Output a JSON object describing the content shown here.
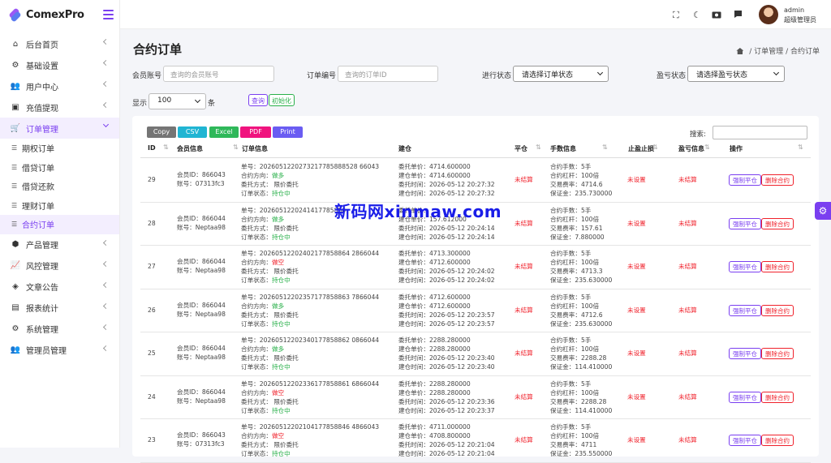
{
  "brand": {
    "name": "ComexPro"
  },
  "colors": {
    "accent": "#7a3ff0",
    "danger": "#f0212b",
    "success": "#29b04a"
  },
  "sidebar": {
    "items": [
      {
        "label": "后台首页",
        "icon": "gauge-icon"
      },
      {
        "label": "基础设置",
        "icon": "cogs-icon"
      },
      {
        "label": "用户中心",
        "icon": "users-icon"
      },
      {
        "label": "充值提现",
        "icon": "money-icon"
      },
      {
        "label": "订单管理",
        "icon": "cart-icon"
      },
      {
        "label": "产品管理",
        "icon": "cubes-icon"
      },
      {
        "label": "风控管理",
        "icon": "chart-icon"
      },
      {
        "label": "文章公告",
        "icon": "layers-icon"
      },
      {
        "label": "报表统计",
        "icon": "report-icon"
      },
      {
        "label": "系统管理",
        "icon": "gear-icon"
      },
      {
        "label": "管理员管理",
        "icon": "admins-icon"
      }
    ],
    "sub": [
      "期权订单",
      "借贷订单",
      "借贷还款",
      "理财订单",
      "合约订单"
    ]
  },
  "user": {
    "name": "admin",
    "role": "超级管理员"
  },
  "page": {
    "title": "合约订单",
    "bc1": "订单管理",
    "bc2": "合约订单",
    "sep": "/"
  },
  "filters": {
    "member_label": "会员账号",
    "member_ph": "查询的会员账号",
    "order_label": "订单编号",
    "order_ph": "查询的订单ID",
    "status_label": "进行状态",
    "status_value": "请选择订单状态",
    "pl_label": "盈亏状态",
    "pl_value": "请选择盈亏状态",
    "show_label": "显示",
    "show_value": "100",
    "show_unit": "条",
    "query": "查询",
    "reset": "初始化"
  },
  "export": [
    "Copy",
    "CSV",
    "Excel",
    "PDF",
    "Print"
  ],
  "search_label": "搜索:",
  "headers": [
    "ID",
    "会员信息",
    "订单信息",
    "建仓",
    "平仓",
    "手数信息",
    "止盈止损",
    "盈亏信息",
    "操作"
  ],
  "rows": [
    {
      "id": "29",
      "m1": "会员ID：866043",
      "m2": "账号：07313fc3",
      "o1": "单号：2026051220273217785888528 66043",
      "o2p": "合约方向：",
      "dir": "做多",
      "o3": "委托方式：  限价委托",
      "o4p": "订单状态：",
      "st": "持仓中",
      "b1": "委托单价：4714.600000",
      "b2": "建仓单价：4714.600000",
      "b3": "委托时间：2026-05-12 20:27:32",
      "b4": "建仓时间：2026-05-12 20:27:32",
      "close": "未结算",
      "h1": "合约手数：5手",
      "h2": "合约杠杆：100倍",
      "h3": "交易费率：4714.6",
      "h4": "保证金：235.730000",
      "sl": "未设置",
      "pl": "未结算",
      "btn1": "强制平仓",
      "btn2": "删除合约"
    },
    {
      "id": "28",
      "m1": "会员ID：866044",
      "m2": "账号：Neptaa98",
      "o1": "单号：2026051220241417785886",
      "o2p": "合约方向：",
      "dir": "做多",
      "o3": "委托方式：  限价委托",
      "o4p": "订单状态：",
      "st": "持仓中",
      "b1": "委托单价：",
      "b2": "建仓单价：157.612000",
      "b3": "委托时间：2026-05-12 20:24:14",
      "b4": "建仓时间：2026-05-12 20:24:14",
      "close": "未结算",
      "h1": "合约手数：5手",
      "h2": "合约杠杆：100倍",
      "h3": "交易费率：157.61",
      "h4": "保证金：7.880000",
      "sl": "未设置",
      "pl": "未结算",
      "btn1": "强制平仓",
      "btn2": "删除合约"
    },
    {
      "id": "27",
      "m1": "会员ID：866044",
      "m2": "账号：Neptaa98",
      "o1": "单号：20260512202402177858864 2866044",
      "o2p": "合约方向：",
      "dir": "做空",
      "o3": "委托方式：  限价委托",
      "o4p": "订单状态：",
      "st": "持仓中",
      "b1": "委托单价：4713.300000",
      "b2": "建仓单价：4712.600000",
      "b3": "委托时间：2026-05-12 20:24:02",
      "b4": "建仓时间：2026-05-12 20:24:02",
      "close": "未结算",
      "h1": "合约手数：5手",
      "h2": "合约杠杆：100倍",
      "h3": "交易费率：4713.3",
      "h4": "保证金：235.630000",
      "sl": "未设置",
      "pl": "未结算",
      "btn1": "强制平仓",
      "btn2": "删除合约"
    },
    {
      "id": "26",
      "m1": "会员ID：866044",
      "m2": "账号：Neptaa98",
      "o1": "单号：20260512202357177858863 7866044",
      "o2p": "合约方向：",
      "dir": "做多",
      "o3": "委托方式：  限价委托",
      "o4p": "订单状态：",
      "st": "持仓中",
      "b1": "委托单价：4712.600000",
      "b2": "建仓单价：4712.600000",
      "b3": "委托时间：2026-05-12 20:23:57",
      "b4": "建仓时间：2026-05-12 20:23:57",
      "close": "未结算",
      "h1": "合约手数：5手",
      "h2": "合约杠杆：100倍",
      "h3": "交易费率：4712.6",
      "h4": "保证金：235.630000",
      "sl": "未设置",
      "pl": "未结算",
      "btn1": "强制平仓",
      "btn2": "删除合约"
    },
    {
      "id": "25",
      "m1": "会员ID：866044",
      "m2": "账号：Neptaa98",
      "o1": "单号：20260512202340177858862 0866044",
      "o2p": "合约方向：",
      "dir": "做多",
      "o3": "委托方式：  限价委托",
      "o4p": "订单状态：",
      "st": "持仓中",
      "b1": "委托单价：2288.280000",
      "b2": "建仓单价：2288.280000",
      "b3": "委托时间：2026-05-12 20:23:40",
      "b4": "建仓时间：2026-05-12 20:23:40",
      "close": "未结算",
      "h1": "合约手数：5手",
      "h2": "合约杠杆：100倍",
      "h3": "交易费率：2288.28",
      "h4": "保证金：114.410000",
      "sl": "未设置",
      "pl": "未结算",
      "btn1": "强制平仓",
      "btn2": "删除合约"
    },
    {
      "id": "24",
      "m1": "会员ID：866044",
      "m2": "账号：Neptaa98",
      "o1": "单号：20260512202336177858861 6866044",
      "o2p": "合约方向：",
      "dir": "做空",
      "o3": "委托方式：  限价委托",
      "o4p": "订单状态：",
      "st": "持仓中",
      "b1": "委托单价：2288.280000",
      "b2": "建仓单价：2288.280000",
      "b3": "委托时间：2026-05-12 20:23:36",
      "b4": "建仓时间：2026-05-12 20:23:37",
      "close": "未结算",
      "h1": "合约手数：5手",
      "h2": "合约杠杆：100倍",
      "h3": "交易费率：2288.28",
      "h4": "保证金：114.410000",
      "sl": "未设置",
      "pl": "未结算",
      "btn1": "强制平仓",
      "btn2": "删除合约"
    },
    {
      "id": "23",
      "m1": "会员ID：866043",
      "m2": "账号：07313fc3",
      "o1": "单号：20260512202104177858846 4866043",
      "o2p": "合约方向：",
      "dir": "做空",
      "o3": "委托方式：  限价委托",
      "o4p": "订单状态：",
      "st": "持仓中",
      "b1": "委托单价：4711.000000",
      "b2": "建仓单价：4708.800000",
      "b3": "委托时间：2026-05-12 20:21:04",
      "b4": "建仓时间：2026-05-12 20:21:04",
      "close": "未结算",
      "h1": "合约手数：5手",
      "h2": "合约杠杆：100倍",
      "h3": "交易费率：4711",
      "h4": "保证金：235.550000",
      "sl": "未设置",
      "pl": "未结算",
      "btn1": "强制平仓",
      "btn2": "删除合约"
    }
  ],
  "watermark": "新码网xinmaw.com"
}
